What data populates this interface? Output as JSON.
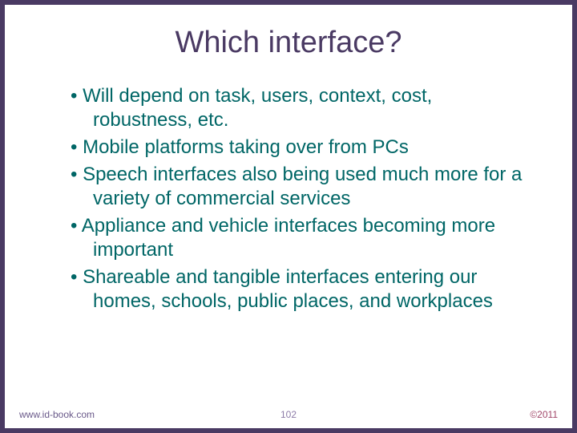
{
  "slide": {
    "title": "Which interface?",
    "bullets": [
      "Will depend on task, users, context, cost, robustness, etc.",
      "Mobile platforms taking over from PCs",
      "Speech interfaces also being used much more for a variety of commercial services",
      "Appliance and vehicle interfaces becoming more important",
      "Shareable and tangible interfaces entering our homes, schools, public places, and workplaces"
    ]
  },
  "footer": {
    "left": "www.id-book.com",
    "center": "102",
    "right": "©2011"
  }
}
